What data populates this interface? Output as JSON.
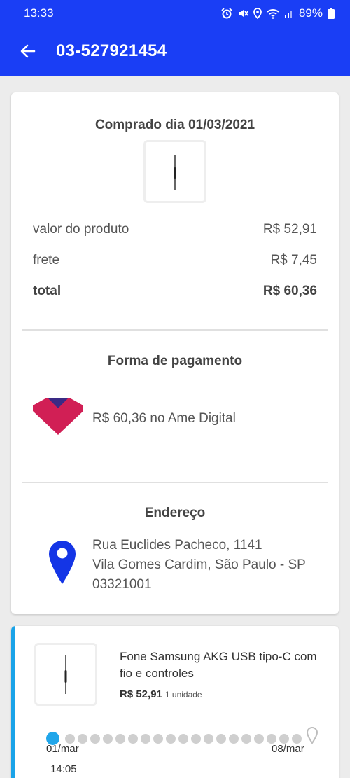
{
  "status": {
    "time": "13:33",
    "battery": "89%"
  },
  "header": {
    "title": "03-527921454"
  },
  "order": {
    "purchase_title": "Comprado dia 01/03/2021",
    "product_value_label": "valor do produto",
    "product_value": "R$ 52,91",
    "shipping_label": "frete",
    "shipping_value": "R$ 7,45",
    "total_label": "total",
    "total_value": "R$ 60,36"
  },
  "payment": {
    "title": "Forma de pagamento",
    "text": "R$ 60,36 no Ame Digital",
    "colors": {
      "heart": "#d11f55",
      "accent": "#3a2a85"
    }
  },
  "address": {
    "title": "Endereço",
    "line1": "Rua Euclides Pacheco, 1141",
    "line2": "Vila Gomes Cardim, São Paulo - SP",
    "line3": "03321001",
    "pin_color": "#1435e6"
  },
  "item": {
    "name": "Fone Samsung AKG USB tipo-C com fio e controles",
    "price": "R$ 52,91",
    "quantity": "1 unidade"
  },
  "tracking": {
    "start_date": "01/mar",
    "start_time": "14:05",
    "end_date": "08/mar",
    "progress_color": "#21a6ea"
  }
}
